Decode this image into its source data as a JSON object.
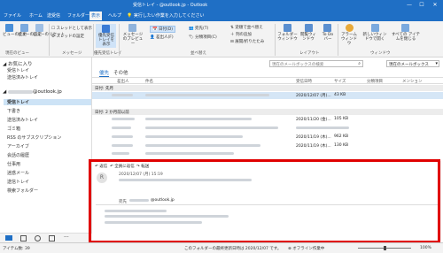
{
  "titlebar": {
    "title": "受信トレイ - @outlook.jp - Outlook",
    "min": "—",
    "max": "☐",
    "close": "✕"
  },
  "tabs": [
    "ファイル",
    "ホーム",
    "送受信",
    "フォルダー",
    "表示",
    "ヘルプ",
    "実行したい作業を入力してください"
  ],
  "ribbon": {
    "current_view_btns": [
      "ビューの変更",
      "ビューの設定",
      "ビューのリセット"
    ],
    "current_view_label": "現在のビュー",
    "message_opts": [
      "スレッドとして表示",
      "スレッドの設定"
    ],
    "message_label": "メッセージ",
    "show_as_conv": "優先受信トレイを表示",
    "preview": "メッセージのプレビュー",
    "arr_items": [
      "日付(D)",
      "差出人(F)",
      "宛先(T)",
      "分類項目(C)"
    ],
    "arr_side": [
      "逆順で並べ替え",
      "列の追加",
      "展開/折りたたみ"
    ],
    "arr_label": "並べ替え",
    "layout_btns": [
      "フォルダーウィンドウ",
      "閲覧ウィンドウ",
      "To Do バー"
    ],
    "layout_label": "レイアウト",
    "window_btns": [
      "アラームウィンドウ",
      "新しいウィンドウで開く",
      "すべての アイテムを閉じる"
    ],
    "window_label": "ウィンドウ",
    "focused_label": "優先受信トレイ"
  },
  "nav": {
    "favorites": "お気に入り",
    "fav_items": [
      "受信トレイ",
      "送信済みトレイ"
    ],
    "account": "@outlook.jp",
    "folders": [
      "受信トレイ",
      "下書き",
      "送信済みトレイ",
      "ゴミ箱",
      "RSS のサブスクリプション",
      "アーカイブ",
      "会話の履歴",
      "仕事用",
      "迷惑メール",
      "送信トレイ",
      "検索フォルダー"
    ]
  },
  "list": {
    "tabs": [
      "優先",
      "その他"
    ],
    "search_placeholder": "現在のメールボックスの検索",
    "scope": "現在のメールボックス",
    "columns": [
      "差出人",
      "件名",
      "受信日時",
      "サイズ",
      "分類項目",
      "メンション"
    ],
    "group1": "日付: 先月",
    "group2": "日付: 2 か月前以前",
    "rows": [
      {
        "date": "2020/12/07 (月)...",
        "size": "43 KB",
        "group": 1
      },
      {
        "date": "2020/11/20 (金)...",
        "size": "105 KB",
        "group": 2
      },
      {
        "date": "",
        "size": "",
        "group": 2
      },
      {
        "date": "2020/11/19 (木)...",
        "size": "962 KB",
        "group": 2
      },
      {
        "date": "2020/11/19 (木)...",
        "size": "130 KB",
        "group": 2
      },
      {
        "date": "",
        "size": "",
        "group": 2
      }
    ]
  },
  "reading": {
    "actions": [
      "返信",
      "全員に返信",
      "転送"
    ],
    "avatar": "R",
    "sent": "2020/12/07 (月) 15:19",
    "to_label": "宛先",
    "to_value": "@outlook.jp"
  },
  "status": {
    "items": "アイテム数: 39",
    "updated": "このフォルダーの最終更新日時は 2020/12/07 です。",
    "offline": "オフライン作業中",
    "zoom": "100%"
  },
  "colors": {
    "brand": "#1f6fc5",
    "highlight": "#e00000"
  }
}
